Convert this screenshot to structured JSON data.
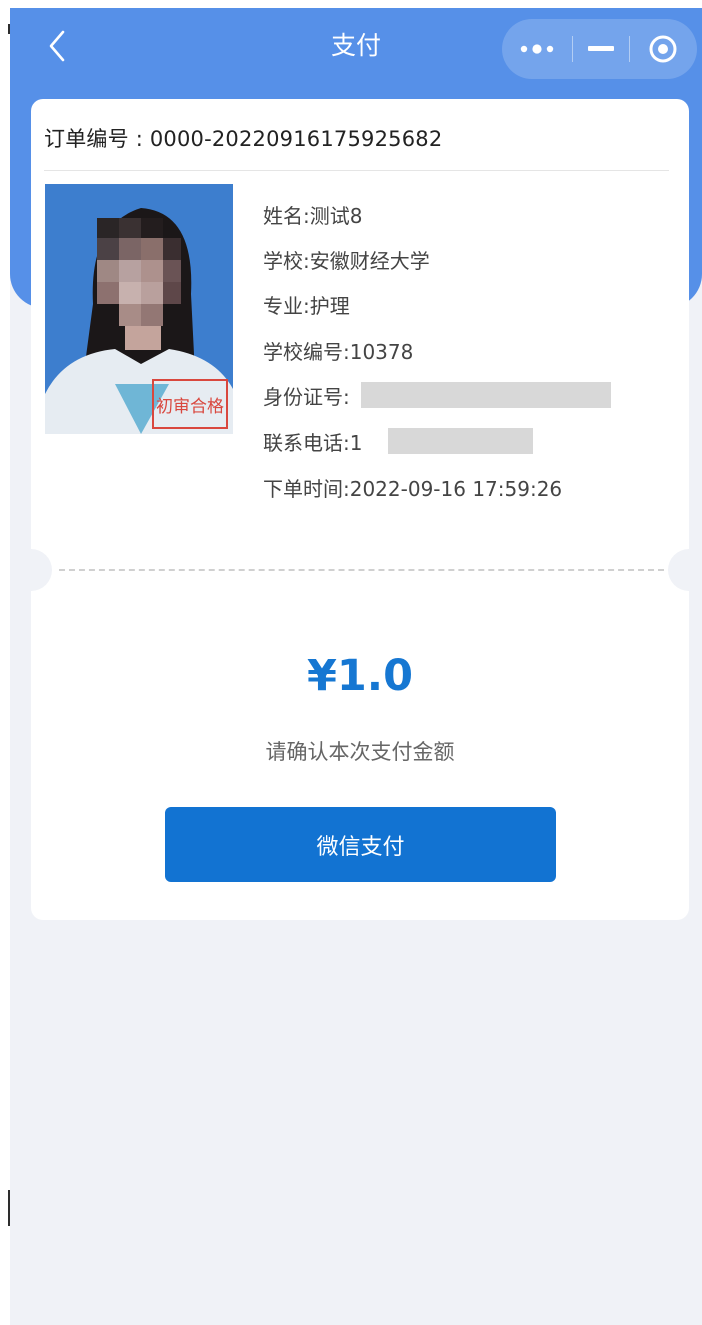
{
  "nav": {
    "title": "支付"
  },
  "order": {
    "label": "订单编号",
    "separator": " : ",
    "number": "0000-20220916175925682"
  },
  "photo": {
    "stamp_text": "初审合格"
  },
  "info": {
    "name": "姓名:测试8",
    "school": "学校:安徽财经大学",
    "major": "专业:护理",
    "school_code": "学校编号:10378",
    "id_number_prefix": "身份证号:",
    "phone_prefix": "联系电话:1",
    "order_time": "下单时间:2022-09-16 17:59:26"
  },
  "payment": {
    "amount": "¥1.0",
    "confirm_text": "请确认本次支付金额",
    "button_label": "微信支付"
  },
  "colors": {
    "header_bg": "#5690e8",
    "accent": "#1273d2",
    "amount": "#1677d2",
    "page_bg": "#f0f2f7"
  },
  "icons": {
    "back": "chevron-left-icon",
    "more": "more-dots-icon",
    "minimize": "minimize-icon",
    "close": "target-close-icon"
  }
}
